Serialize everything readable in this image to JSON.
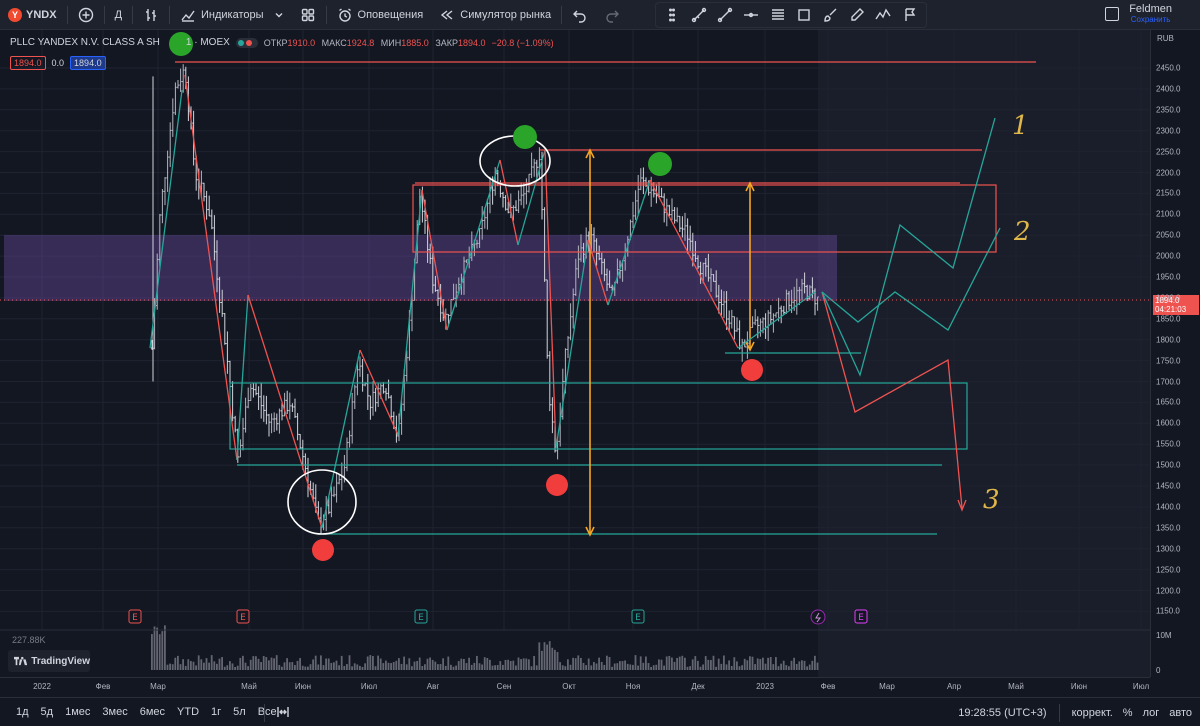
{
  "app": {
    "ticker": "YNDX",
    "logo_letter": "Y",
    "indicators_label": "Индикаторы",
    "interval_label": "Д",
    "alerts_label": "Оповещения",
    "replay_label": "Симулятор рынка",
    "user_name": "Feldmen",
    "user_status": "Сохранить"
  },
  "legend": {
    "symbol": "PLLC YANDEX N.V. CLASS A SH",
    "symbol_suffix": "1 · MOEX",
    "open_label": "ОТКР",
    "open": "1910.0",
    "high_label": "МАКС",
    "high": "1924.8",
    "low_label": "МИН",
    "low": "1885.0",
    "close_label": "ЗАКР",
    "close": "1894.0",
    "change": "−20.8 (−1.09%)",
    "bid": "1894.0",
    "spread": "0.0",
    "ask": "1894.0"
  },
  "price_axis": {
    "currency": "RUB",
    "ticks": [
      "2450.0",
      "2400.0",
      "2350.0",
      "2300.0",
      "2250.0",
      "2200.0",
      "2150.0",
      "2100.0",
      "2050.0",
      "2000.0",
      "1950.0",
      "1900.0",
      "1850.0",
      "1800.0",
      "1750.0",
      "1700.0",
      "1650.0",
      "1600.0",
      "1550.0",
      "1500.0",
      "1450.0",
      "1400.0",
      "1350.0",
      "1300.0",
      "1250.0",
      "1200.0",
      "1150.0"
    ],
    "current_price": "1894.0",
    "countdown": "04:21:03"
  },
  "volume": {
    "label": "227.88K",
    "axis_top": "10M",
    "axis_bottom": "0"
  },
  "time_axis": {
    "labels": [
      "2022",
      "Фев",
      "Мар",
      "Май",
      "Июн",
      "Июл",
      "Авг",
      "Сен",
      "Окт",
      "Ноя",
      "Дек",
      "2023",
      "Фев",
      "Мар",
      "Апр",
      "Май",
      "Июн",
      "Июл"
    ]
  },
  "annotations": {
    "handwritten": [
      "1",
      "2",
      "3"
    ]
  },
  "events": {
    "earnings_marker": "E"
  },
  "bottom": {
    "ranges": [
      "1д",
      "5д",
      "1мес",
      "3мес",
      "6мес",
      "YTD",
      "1г",
      "5л",
      "Все"
    ],
    "clock": "19:28:55 (UTC+3)",
    "correction": "коррект.",
    "percent": "%",
    "log": "лог",
    "auto": "авто"
  },
  "branding": {
    "text": "TradingView"
  },
  "colors": {
    "bg": "#131722",
    "up": "#26a69a",
    "down": "#ef5350",
    "zone": "#7e57c2",
    "accent": "#2962ff",
    "orange": "#f5a623",
    "green_marker": "#2aa52a",
    "red_marker": "#f23d3d"
  }
}
